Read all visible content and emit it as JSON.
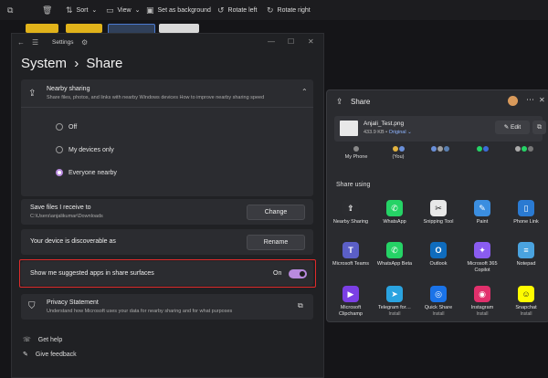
{
  "toolbar": {
    "sort_label": "Sort",
    "view_label": "View",
    "set_background_label": "Set as background",
    "rotate_left_label": "Rotate left",
    "rotate_right_label": "Rotate right"
  },
  "settings": {
    "window_title": "Settings",
    "breadcrumb_parent": "System",
    "breadcrumb_separator": "›",
    "breadcrumb_current": "Share",
    "nearby": {
      "title": "Nearby sharing",
      "description": "Share files, photos, and links with nearby Windows devices How to improve nearby sharing speed",
      "options": [
        "Off",
        "My devices only",
        "Everyone nearby"
      ],
      "selected_index": 2
    },
    "save_files": {
      "title": "Save files I receive to",
      "path": "C:\\Users\\anjalikumar\\Downloads",
      "button": "Change"
    },
    "discoverable": {
      "text": "Your device is discoverable as",
      "button": "Rename"
    },
    "suggested_apps": {
      "text": "Show me suggested apps in share surfaces",
      "state_label": "On"
    },
    "privacy": {
      "title": "Privacy Statement",
      "description": "Understand how Microsoft uses your data for nearby sharing and for what purposes"
    },
    "footer": {
      "get_help": "Get help",
      "give_feedback": "Give feedback"
    }
  },
  "share": {
    "title": "Share",
    "file": {
      "name": "Anjali_Test.png",
      "size": "433.9 KB",
      "quality": "Original"
    },
    "edit_label": "Edit",
    "contacts": [
      {
        "label": "My Phone"
      },
      {
        "label": "(You)"
      }
    ],
    "share_using_label": "Share using",
    "apps": [
      {
        "name": "Nearby Sharing",
        "sub": "",
        "icon": "nearby-share-icon",
        "color": "#2b2c30",
        "glyph": "⇪"
      },
      {
        "name": "WhatsApp",
        "sub": "",
        "icon": "whatsapp-icon",
        "color": "#25d366",
        "glyph": "✆"
      },
      {
        "name": "Snipping Tool",
        "sub": "",
        "icon": "snipping-tool-icon",
        "color": "#e8e8e8",
        "glyph": "✂"
      },
      {
        "name": "Paint",
        "sub": "",
        "icon": "paint-icon",
        "color": "#3b8ee0",
        "glyph": "✎"
      },
      {
        "name": "Phone Link",
        "sub": "",
        "icon": "phone-link-icon",
        "color": "#2a7ad2",
        "glyph": "▯"
      },
      {
        "name": "Microsoft Teams",
        "sub": "",
        "icon": "teams-icon",
        "color": "#5b5fc7",
        "glyph": "T"
      },
      {
        "name": "WhatsApp Beta",
        "sub": "",
        "icon": "whatsapp-beta-icon",
        "color": "#25d366",
        "glyph": "✆"
      },
      {
        "name": "Outlook",
        "sub": "",
        "icon": "outlook-icon",
        "color": "#0f6cbd",
        "glyph": "O"
      },
      {
        "name": "Microsoft 365 Copilot",
        "sub": "",
        "icon": "copilot-icon",
        "color": "#8a5cf0",
        "glyph": "✦"
      },
      {
        "name": "Notepad",
        "sub": "",
        "icon": "notepad-icon",
        "color": "#4aa3df",
        "glyph": "≡"
      },
      {
        "name": "Microsoft Clipchamp",
        "sub": "",
        "icon": "clipchamp-icon",
        "color": "#7b3fe4",
        "glyph": "▶"
      },
      {
        "name": "Telegram for…",
        "sub": "Install",
        "icon": "telegram-icon",
        "color": "#2aa3e0",
        "glyph": "➤"
      },
      {
        "name": "Quick Share",
        "sub": "Install",
        "icon": "quick-share-icon",
        "color": "#1a73e8",
        "glyph": "◎"
      },
      {
        "name": "Instagram",
        "sub": "Install",
        "icon": "instagram-icon",
        "color": "#e1306c",
        "glyph": "◉"
      },
      {
        "name": "Snapchat",
        "sub": "Install",
        "icon": "snapchat-icon",
        "color": "#fffc00",
        "glyph": "☺"
      }
    ]
  },
  "colors": {
    "accent": "#b98adf",
    "highlight_border": "#e02b2b"
  }
}
